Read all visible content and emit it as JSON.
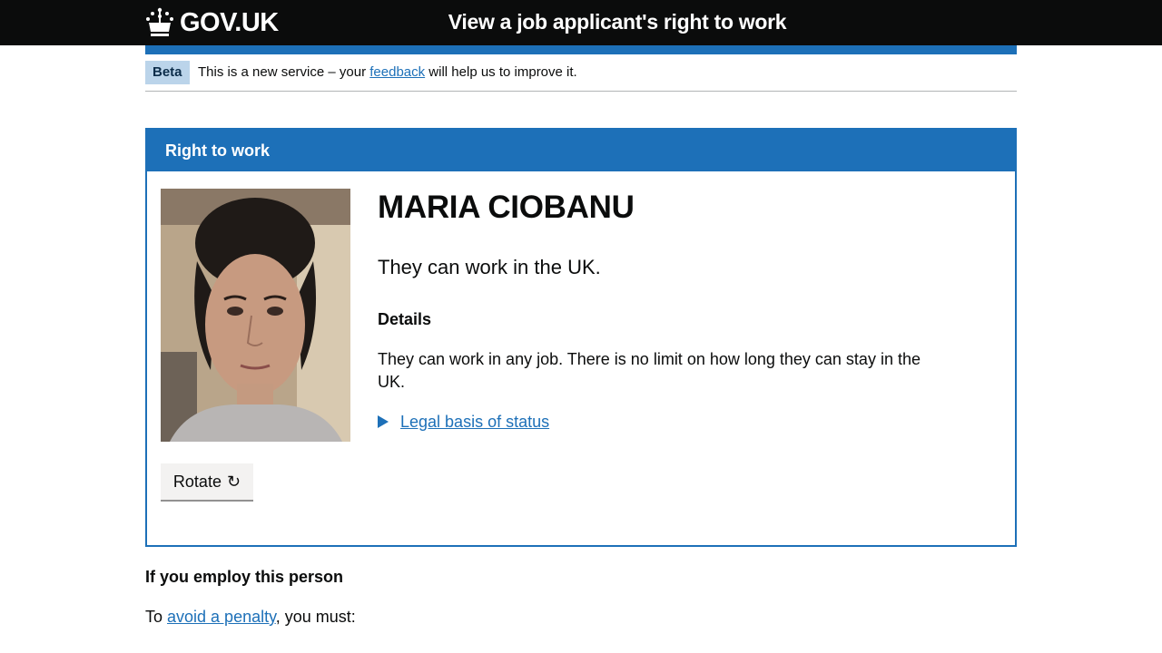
{
  "header": {
    "logo_text": "GOV.UK",
    "service_name": "View a job applicant's right to work"
  },
  "phase_banner": {
    "tag": "Beta",
    "text_before": "This is a new service – your ",
    "link": "feedback",
    "text_after": " will help us to improve it."
  },
  "panel": {
    "title": "Right to work",
    "person_name": "MARIA CIOBANU",
    "status": "They can work in the UK.",
    "details_heading": "Details",
    "details_text": "They can work in any job. There is no limit on how long they can stay in the UK.",
    "legal_link": "Legal basis of status",
    "rotate_label": "Rotate",
    "rotate_icon": "↻"
  },
  "employ": {
    "heading": "If you employ this person",
    "text_before": "To ",
    "link": "avoid a penalty",
    "text_after": ", you must:"
  },
  "colors": {
    "header_bg": "#0b0c0c",
    "brand_blue": "#1d70b8",
    "tag_bg": "#bbd4ea"
  }
}
